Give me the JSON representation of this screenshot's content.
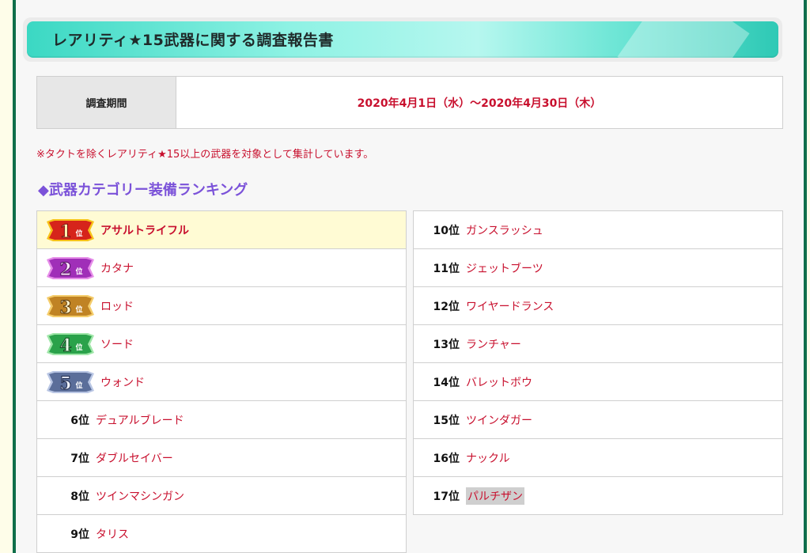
{
  "report": {
    "title": "レアリティ★15武器に関する調査報告書",
    "period_label": "調査期間",
    "period_value": "2020年4月1日（水）～2020年4月30日（木）",
    "note": "※タクトを除くレアリティ★15以上の武器を対象として集計しています。",
    "section_heading": "◆武器カテゴリー装備ランキング"
  },
  "badges": {
    "rank1": {
      "num": "1",
      "suffix": "位",
      "color": "#d6241b",
      "accent": "#f7c21a"
    },
    "rank2": {
      "num": "2",
      "suffix": "位",
      "color": "#a02fb8",
      "accent": "#e58ce8"
    },
    "rank3": {
      "num": "3",
      "suffix": "位",
      "color": "#c08324",
      "accent": "#f4cc6a"
    },
    "rank4": {
      "num": "4",
      "suffix": "位",
      "color": "#2aa24a",
      "accent": "#9fe6a8"
    },
    "rank5": {
      "num": "5",
      "suffix": "位",
      "color": "#5b6e9a",
      "accent": "#b9c6e4"
    }
  },
  "left_list": [
    {
      "rank": "",
      "name": "アサルトライフル"
    },
    {
      "rank": "",
      "name": "カタナ"
    },
    {
      "rank": "",
      "name": "ロッド"
    },
    {
      "rank": "",
      "name": "ソード"
    },
    {
      "rank": "",
      "name": "ウォンド"
    },
    {
      "rank": "6位",
      "name": "デュアルブレード"
    },
    {
      "rank": "7位",
      "name": "ダブルセイバー"
    },
    {
      "rank": "8位",
      "name": "ツインマシンガン"
    },
    {
      "rank": "9位",
      "name": "タリス"
    }
  ],
  "right_list": [
    {
      "rank": "10位",
      "name": "ガンスラッシュ"
    },
    {
      "rank": "11位",
      "name": "ジェットブーツ"
    },
    {
      "rank": "12位",
      "name": "ワイヤードランス"
    },
    {
      "rank": "13位",
      "name": "ランチャー"
    },
    {
      "rank": "14位",
      "name": "バレットボウ"
    },
    {
      "rank": "15位",
      "name": "ツインダガー"
    },
    {
      "rank": "16位",
      "name": "ナックル"
    },
    {
      "rank": "17位",
      "name": "パルチザン"
    }
  ]
}
